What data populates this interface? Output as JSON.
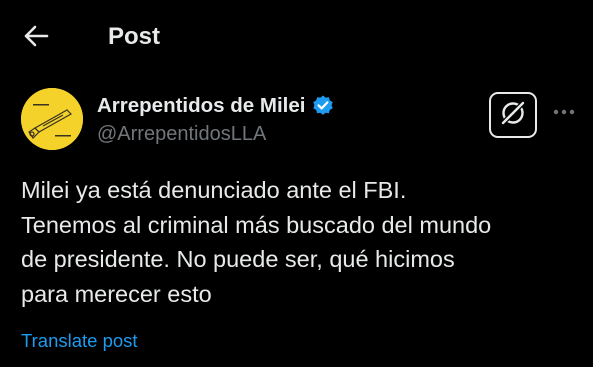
{
  "header": {
    "title": "Post",
    "back_icon": "arrow-left-icon"
  },
  "post": {
    "author": {
      "name": "Arrepentidos de Milei",
      "handle": "@ArrepentidosLLA",
      "verified": true,
      "avatar_color": "#f4d22a"
    },
    "text_lines": [
      "Milei ya está denunciado ante el FBI.",
      "Tenemos al criminal más buscado del mundo",
      "de presidente. No puede ser, qué hicimos",
      "para merecer esto"
    ],
    "translate_label": "Translate post",
    "grok_icon": "grok-icon",
    "more_icon": "more-horizontal-icon"
  },
  "colors": {
    "background": "#000000",
    "text": "#e7e9ea",
    "secondary_text": "#71767b",
    "link": "#1d9bf0",
    "verified_badge": "#1d9bf0"
  }
}
